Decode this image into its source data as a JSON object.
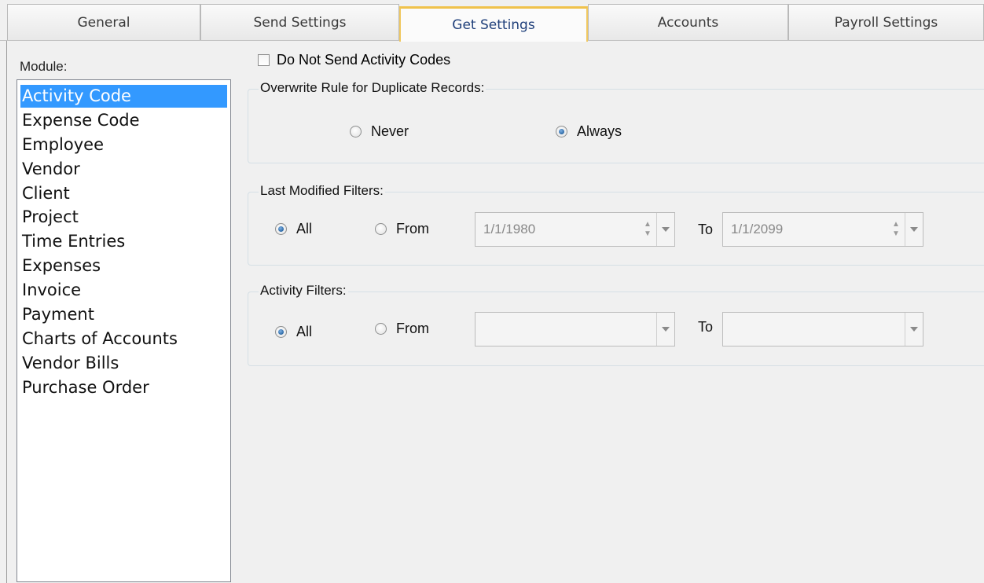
{
  "tabs": [
    {
      "label": "General"
    },
    {
      "label": "Send Settings"
    },
    {
      "label": "Get Settings"
    },
    {
      "label": "Accounts"
    },
    {
      "label": "Payroll Settings"
    }
  ],
  "active_tab": "Get Settings",
  "module": {
    "label": "Module:",
    "items": [
      {
        "label": "Activity Code"
      },
      {
        "label": "Expense Code"
      },
      {
        "label": "Employee"
      },
      {
        "label": "Vendor"
      },
      {
        "label": "Client"
      },
      {
        "label": "Project"
      },
      {
        "label": "Time Entries"
      },
      {
        "label": "Expenses"
      },
      {
        "label": "Invoice"
      },
      {
        "label": "Payment"
      },
      {
        "label": "Charts of Accounts"
      },
      {
        "label": "Vendor Bills"
      },
      {
        "label": "Purchase Order"
      }
    ],
    "selected": "Activity Code"
  },
  "do_not_send": {
    "label": "Do Not Send Activity Codes",
    "checked": false
  },
  "overwrite_rule": {
    "title": "Overwrite Rule for Duplicate Records:",
    "never_label": "Never",
    "always_label": "Always",
    "selected": "Always"
  },
  "last_modified": {
    "title": "Last Modified Filters:",
    "all_label": "All",
    "from_label": "From",
    "to_label": "To",
    "from_value": "1/1/1980",
    "to_value": "1/1/2099",
    "selected": "All"
  },
  "activity_filters": {
    "title": "Activity Filters:",
    "all_label": "All",
    "from_label": "From",
    "to_label": "To",
    "from_value": "",
    "to_value": "",
    "selected": "All"
  },
  "colors": {
    "selection": "#3399ff",
    "active_tab_accent": "#f0c24b",
    "active_tab_text": "#1f3f7a"
  }
}
